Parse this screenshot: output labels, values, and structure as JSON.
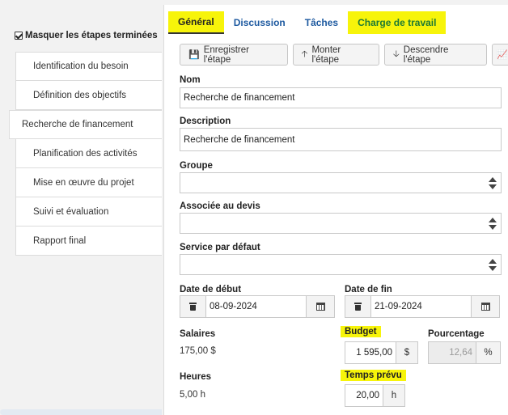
{
  "sidebar": {
    "hide_completed_label": "Masquer les étapes terminées",
    "steps": [
      {
        "label": "Identification du besoin"
      },
      {
        "label": "Définition des objectifs"
      },
      {
        "label": "Recherche de financement"
      },
      {
        "label": "Planification des activités"
      },
      {
        "label": "Mise en œuvre du projet"
      },
      {
        "label": "Suivi et évaluation"
      },
      {
        "label": "Rapport final"
      }
    ]
  },
  "tabs": [
    {
      "label": "Général"
    },
    {
      "label": "Discussion"
    },
    {
      "label": "Tâches"
    },
    {
      "label": "Charge de travail"
    }
  ],
  "toolbar": {
    "save_label": "Enregistrer l'étape",
    "up_label": "Monter l'étape",
    "down_label": "Descendre l'étape"
  },
  "form": {
    "name_label": "Nom",
    "name_value": "Recherche de financement",
    "description_label": "Description",
    "description_value": "Recherche de financement",
    "group_label": "Groupe",
    "quote_label": "Associée au devis",
    "service_label": "Service par défaut",
    "start_label": "Date de début",
    "start_value": "08-09-2024",
    "end_label": "Date de fin",
    "end_value": "21-09-2024",
    "salaries_label": "Salaires",
    "salaries_value": "175,00 $",
    "budget_label": "Budget",
    "budget_value": "1 595,00",
    "budget_unit": "$",
    "percent_label": "Pourcentage",
    "percent_value": "12,64",
    "percent_unit": "%",
    "hours_label": "Heures",
    "hours_value": "5,00 h",
    "planned_label": "Temps prévu",
    "planned_value": "20,00",
    "planned_unit": "h"
  },
  "colors": {
    "highlight": "#f7f40a",
    "link": "#1e5aa0",
    "green_tab": "#1d7a34"
  }
}
